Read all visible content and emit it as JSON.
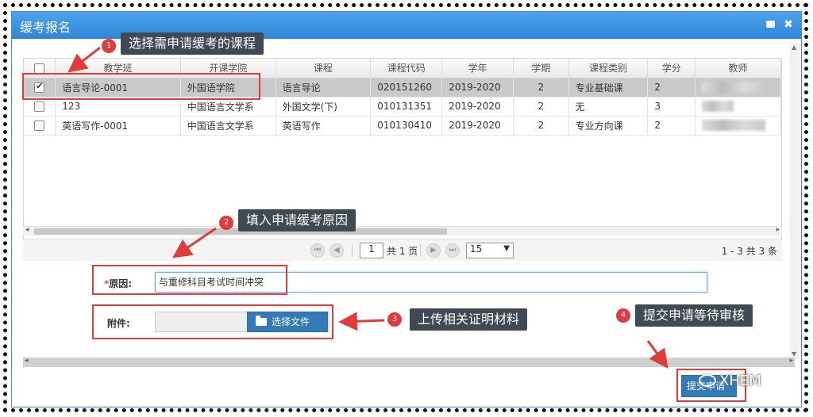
{
  "dialog": {
    "title": "缓考报名",
    "close_icon": "✖"
  },
  "table": {
    "headers": [
      "教学班",
      "开课学院",
      "课程",
      "课程代码",
      "学年",
      "学期",
      "课程类别",
      "学分",
      "教师"
    ],
    "rows": [
      {
        "checked": true,
        "class": "语言导论-0001",
        "college": "外国语学院",
        "course": "语言导论",
        "code": "020151260",
        "year": "2019-2020",
        "term": "2",
        "category": "专业基础课",
        "credit": "2"
      },
      {
        "checked": false,
        "class": "123",
        "college": "中国语言文学系",
        "course": "外国文学(下)",
        "code": "010131351",
        "year": "2019-2020",
        "term": "2",
        "category": "无",
        "credit": "3"
      },
      {
        "checked": false,
        "class": "英语写作-0001",
        "college": "中国语言文学系",
        "course": "英语写作",
        "code": "010130410",
        "year": "2019-2020",
        "term": "2",
        "category": "专业方向课",
        "credit": "2"
      }
    ]
  },
  "pager": {
    "page": "1",
    "total": "共 1 页",
    "size": "15",
    "range": "1 - 3 共 3 条"
  },
  "form": {
    "reason_label": "原因:",
    "reason_required": "*",
    "reason_value": "与重修科目考试时间冲突",
    "attachment_label": "附件:",
    "choose_file": "选择文件"
  },
  "submit_label": "提交申请",
  "callouts": {
    "step1": {
      "num": "1",
      "text": "选择需申请缓考的课程"
    },
    "step2": {
      "num": "2",
      "text": "填入申请缓考原因"
    },
    "step3": {
      "num": "3",
      "text": "上传相关证明材料"
    },
    "step4": {
      "num": "4",
      "text": "提交申请等待审核"
    }
  },
  "watermark": "XHEM",
  "colors": {
    "accent": "#337ab7",
    "annotation": "#e23b3b",
    "titlebar": "#3b8fdc"
  }
}
